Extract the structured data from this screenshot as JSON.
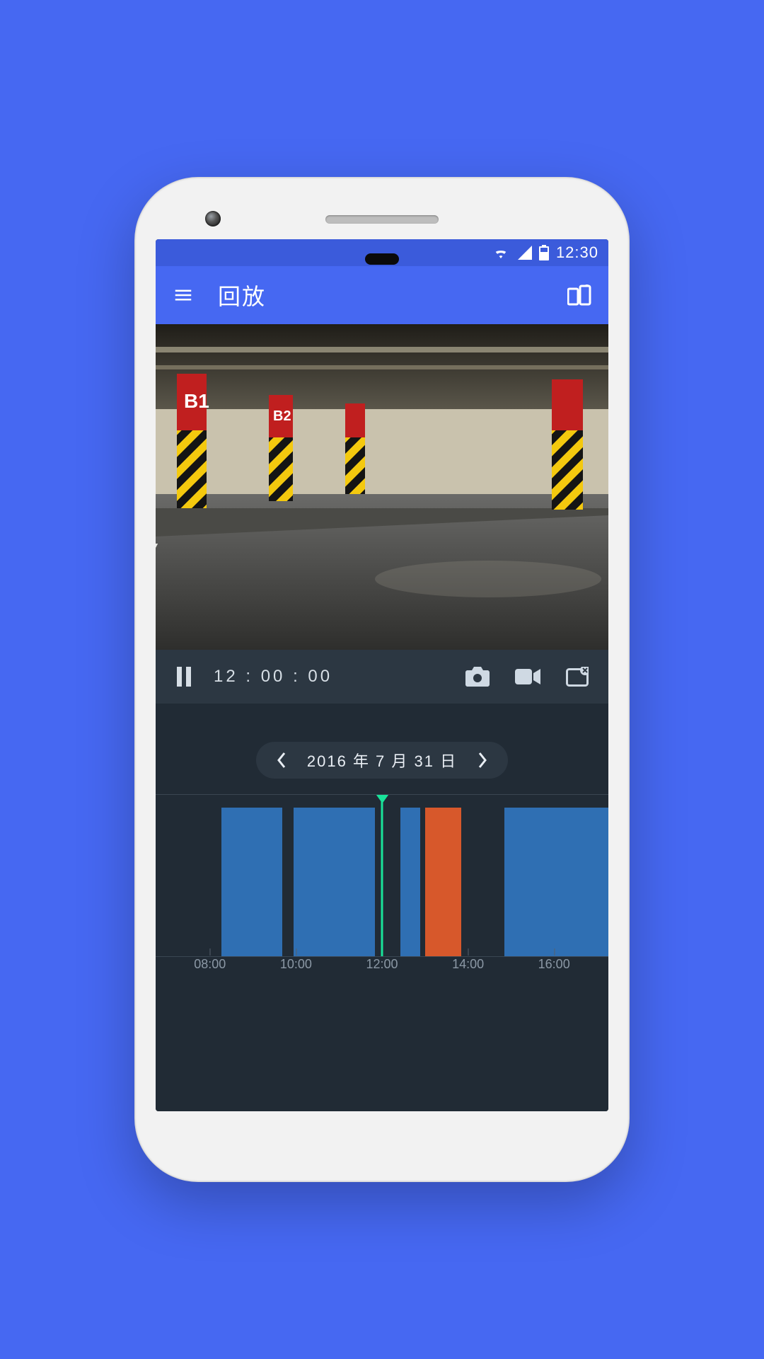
{
  "status": {
    "time": "12:30"
  },
  "app_bar": {
    "title": "回放"
  },
  "playback": {
    "timecode": "12 : 00 : 00"
  },
  "date_picker": {
    "date_label": "2016 年 7 月 31 日"
  },
  "timeline": {
    "ticks": [
      "08:00",
      "10:00",
      "12:00",
      "14:00",
      "16:00"
    ],
    "tick_positions_pct": [
      12,
      31,
      50,
      69,
      88
    ],
    "playhead_pct": 50,
    "segments": [
      {
        "type": "blue",
        "left_pct": 14.5,
        "width_pct": 13.5
      },
      {
        "type": "blue",
        "left_pct": 30.5,
        "width_pct": 18.0
      },
      {
        "type": "blue",
        "left_pct": 54.0,
        "width_pct": 4.5
      },
      {
        "type": "orange",
        "left_pct": 59.5,
        "width_pct": 8.0
      },
      {
        "type": "blue",
        "left_pct": 77.0,
        "width_pct": 23.0
      }
    ]
  },
  "video_scene": {
    "description": "Indoor parking garage, red pillars with yellow/black hazard stripes, labels B1/B2",
    "pillar_labels": [
      "B1",
      "B2"
    ]
  }
}
